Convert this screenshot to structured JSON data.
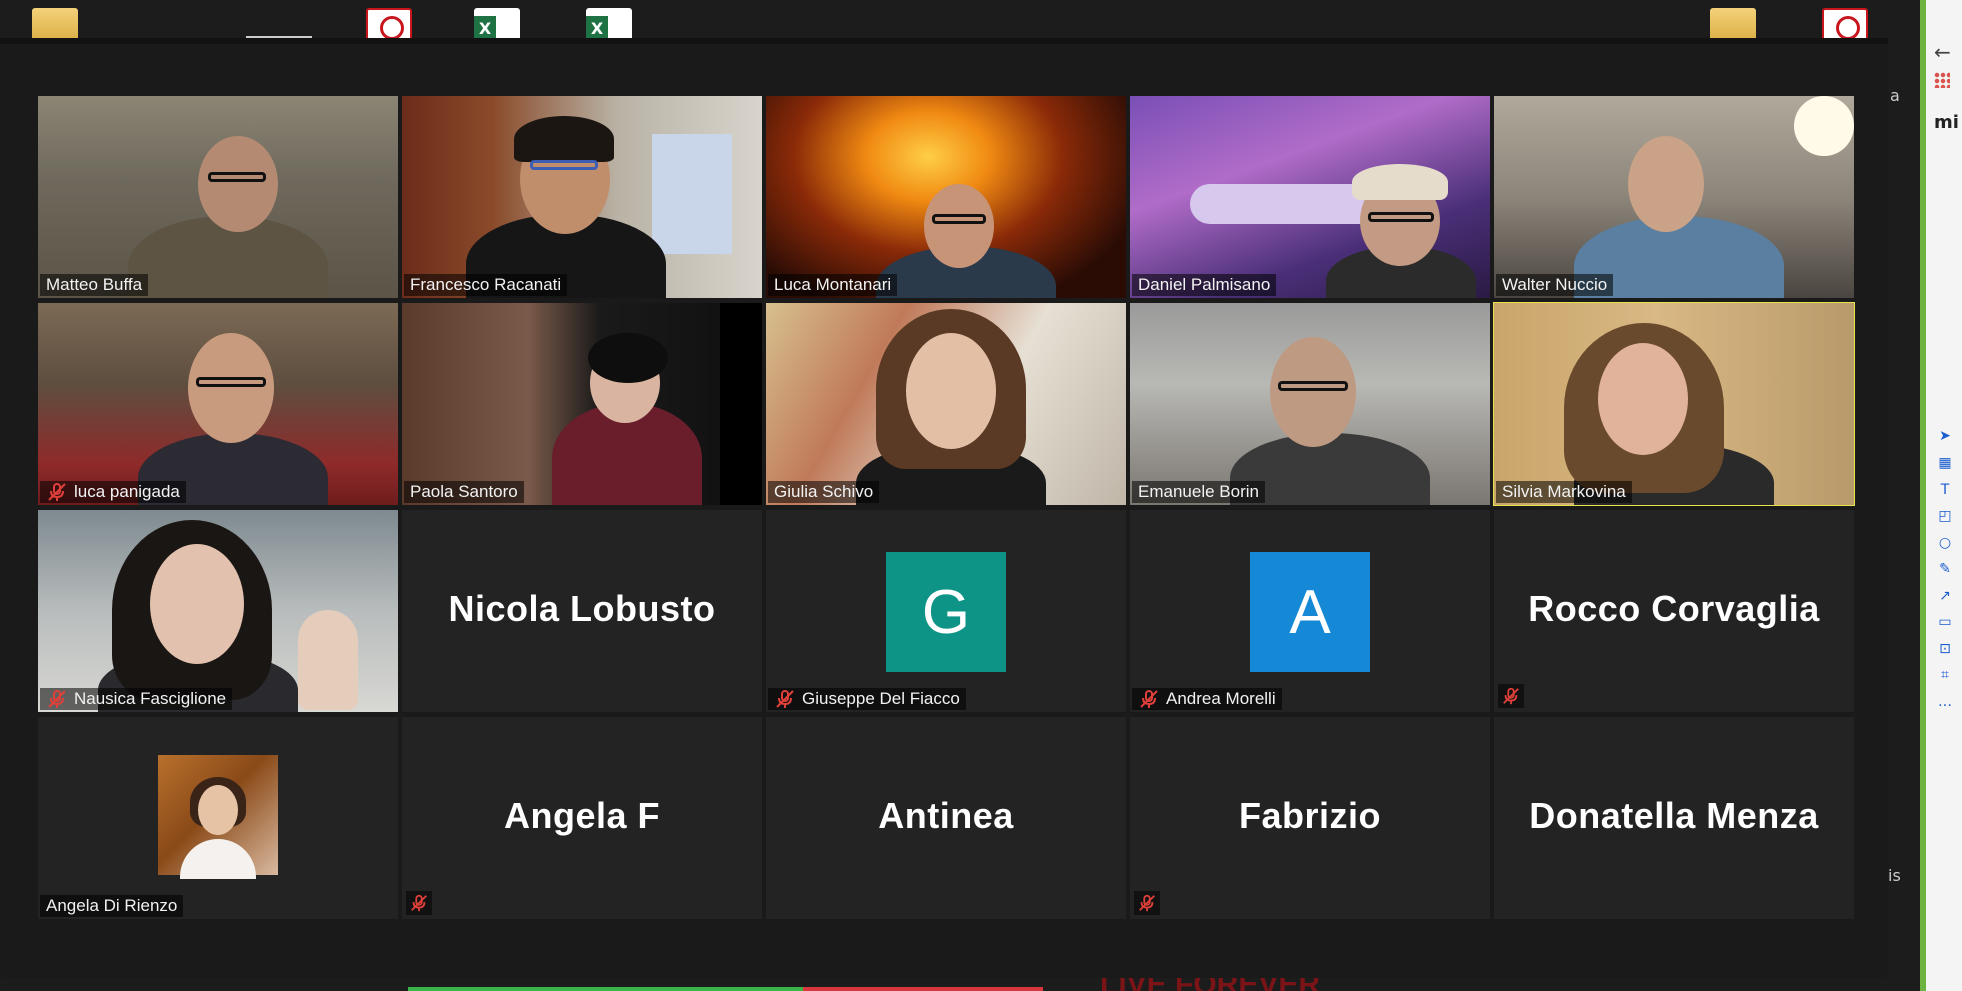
{
  "app": {
    "type": "video-conference-gallery-view"
  },
  "colors": {
    "active_speaker_border": "#e8e24a",
    "tile_background": "#232323",
    "mute_icon": "#e0403a",
    "avatar_G": "#0e9486",
    "avatar_A": "#1589d6",
    "side_accent": "#6cb33f"
  },
  "participants": [
    {
      "name": "Matteo Buffa",
      "video": true,
      "muted": false
    },
    {
      "name": "Francesco Racanati",
      "video": true,
      "muted": false
    },
    {
      "name": "Luca Montanari",
      "video": true,
      "muted": false
    },
    {
      "name": "Daniel Palmisano",
      "video": true,
      "muted": false
    },
    {
      "name": "Walter Nuccio",
      "video": true,
      "muted": false
    },
    {
      "name": "luca panigada",
      "video": true,
      "muted": true
    },
    {
      "name": "Paola Santoro",
      "video": true,
      "muted": false
    },
    {
      "name": "Giulia Schivo",
      "video": true,
      "muted": false
    },
    {
      "name": "Emanuele Borin",
      "video": true,
      "muted": false
    },
    {
      "name": "Silvia Markovina",
      "video": true,
      "muted": false,
      "active_speaker": true
    },
    {
      "name": "Nausica Fasciglione",
      "video": true,
      "muted": true
    },
    {
      "name": "Nicola Lobusto",
      "video": false,
      "muted": false
    },
    {
      "name": "Giuseppe Del Fiacco",
      "video": false,
      "muted": true,
      "avatar_letter": "G"
    },
    {
      "name": "Andrea Morelli",
      "video": false,
      "muted": true,
      "avatar_letter": "A"
    },
    {
      "name": "Rocco Corvaglia",
      "video": false,
      "muted": true
    },
    {
      "name": "Angela Di Rienzo",
      "video": false,
      "muted": false,
      "photo": true
    },
    {
      "name": "Angela F",
      "video": false,
      "muted": true
    },
    {
      "name": "Antinea",
      "video": false,
      "muted": false
    },
    {
      "name": "Fabrizio",
      "video": false,
      "muted": true
    },
    {
      "name": "Donatella Menza",
      "video": false,
      "muted": false
    }
  ],
  "side_panel": {
    "text": "mi",
    "icons": [
      "pointer-icon",
      "table-icon",
      "text-icon",
      "sticky-note-icon",
      "circle-icon",
      "pen-icon",
      "line-icon",
      "comment-icon",
      "frame-icon",
      "crop-icon",
      "more-icon"
    ]
  },
  "edge_text": {
    "right_a": "a",
    "right_is": "is"
  },
  "bottom_logo_text": "LIVE FOREVER"
}
